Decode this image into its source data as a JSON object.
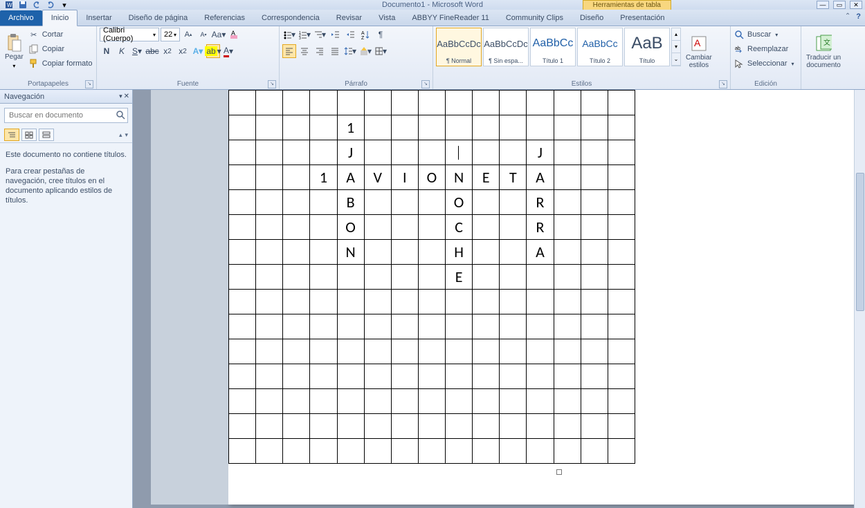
{
  "titlebar": {
    "doc_title": "Documento1 - Microsoft Word",
    "table_tools": "Herramientas de tabla"
  },
  "tabs": {
    "file": "Archivo",
    "home": "Inicio",
    "insert": "Insertar",
    "page_layout": "Diseño de página",
    "references": "Referencias",
    "mailings": "Correspondencia",
    "review": "Revisar",
    "view": "Vista",
    "abbyy": "ABBYY FineReader 11",
    "community": "Community Clips",
    "design": "Diseño",
    "presentation": "Presentación"
  },
  "clipboard": {
    "group": "Portapapeles",
    "paste": "Pegar",
    "cut": "Cortar",
    "copy": "Copiar",
    "format_painter": "Copiar formato"
  },
  "font": {
    "group": "Fuente",
    "name": "Calibri (Cuerpo)",
    "size": "22"
  },
  "paragraph": {
    "group": "Párrafo"
  },
  "styles": {
    "group": "Estilos",
    "change_styles": "Cambiar\nestilos",
    "items": [
      {
        "sample": "AaBbCcDc",
        "name": "¶ Normal"
      },
      {
        "sample": "AaBbCcDc",
        "name": "¶ Sin espa..."
      },
      {
        "sample": "AaBbCc",
        "name": "Título 1"
      },
      {
        "sample": "AaBbCc",
        "name": "Título 2"
      },
      {
        "sample": "AaB",
        "name": "Título"
      }
    ]
  },
  "editing": {
    "group": "Edición",
    "find": "Buscar",
    "replace": "Reemplazar",
    "select": "Seleccionar"
  },
  "translate": {
    "label": "Traducir un\ndocumento"
  },
  "nav": {
    "title": "Navegación",
    "search_placeholder": "Buscar en documento",
    "msg1": "Este documento no contiene títulos.",
    "msg2": "Para crear pestañas de navegación, cree títulos en el documento aplicando estilos de títulos."
  },
  "table": {
    "rows": 15,
    "cols": 15,
    "cells": {
      "1-4": "1",
      "2-4": "J",
      "2-11": "J",
      "3-3": "1",
      "3-4": "A",
      "3-5": "V",
      "3-6": "I",
      "3-7": "O",
      "3-8": "N",
      "3-9": "E",
      "3-10": "T",
      "3-11": "A",
      "4-4": "B",
      "4-8": "O",
      "4-11": "R",
      "5-4": "O",
      "5-8": "C",
      "5-11": "R",
      "6-4": "N",
      "6-8": "H",
      "6-11": "A",
      "7-8": "E"
    },
    "cursor_cell": "2-8"
  }
}
